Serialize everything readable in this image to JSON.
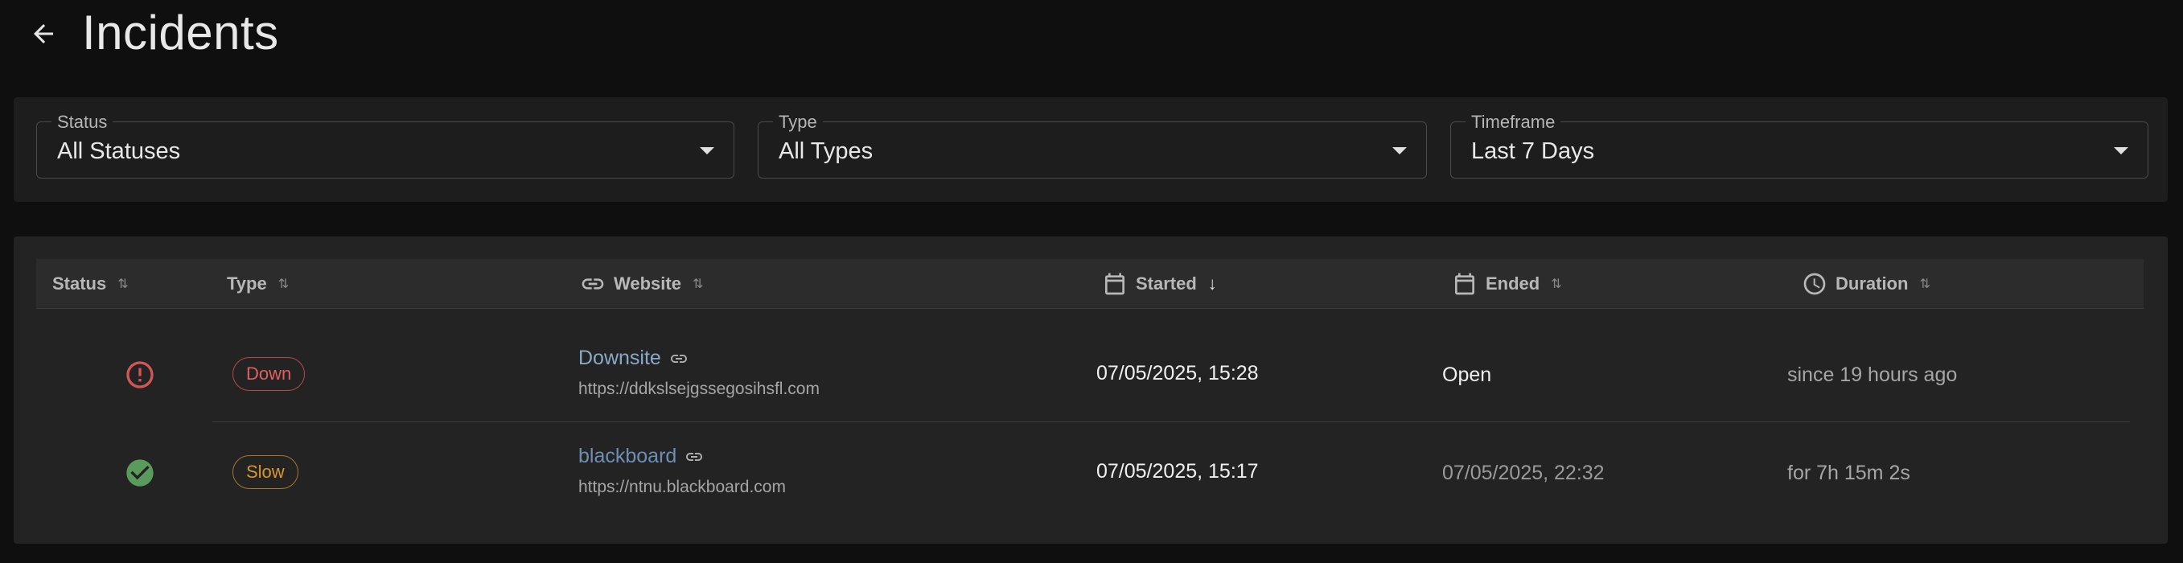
{
  "page": {
    "title": "Incidents"
  },
  "filters": [
    {
      "label": "Status",
      "value": "All Statuses"
    },
    {
      "label": "Type",
      "value": "All Types"
    },
    {
      "label": "Timeframe",
      "value": "Last 7 Days"
    }
  ],
  "table": {
    "columns": {
      "status": "Status",
      "type": "Type",
      "website": "Website",
      "started": "Started",
      "ended": "Ended",
      "duration": "Duration"
    },
    "rows": [
      {
        "status": "error",
        "type": "Down",
        "site_name": "Downsite",
        "site_url": "https://ddkslsejgssegosihsfl.com",
        "started": "07/05/2025, 15:28",
        "ended": "Open",
        "duration": "since 19 hours ago"
      },
      {
        "status": "resolved",
        "type": "Slow",
        "site_name": "blackboard",
        "site_url": "https://ntnu.blackboard.com",
        "started": "07/05/2025, 15:17",
        "ended": "07/05/2025, 22:32",
        "duration": "for 7h 15m 2s"
      }
    ]
  },
  "colors": {
    "site_link_down": "#8aa8c8",
    "site_link_slow": "#6c8fb3",
    "error": "#d25656",
    "success": "#5a9a5c"
  }
}
